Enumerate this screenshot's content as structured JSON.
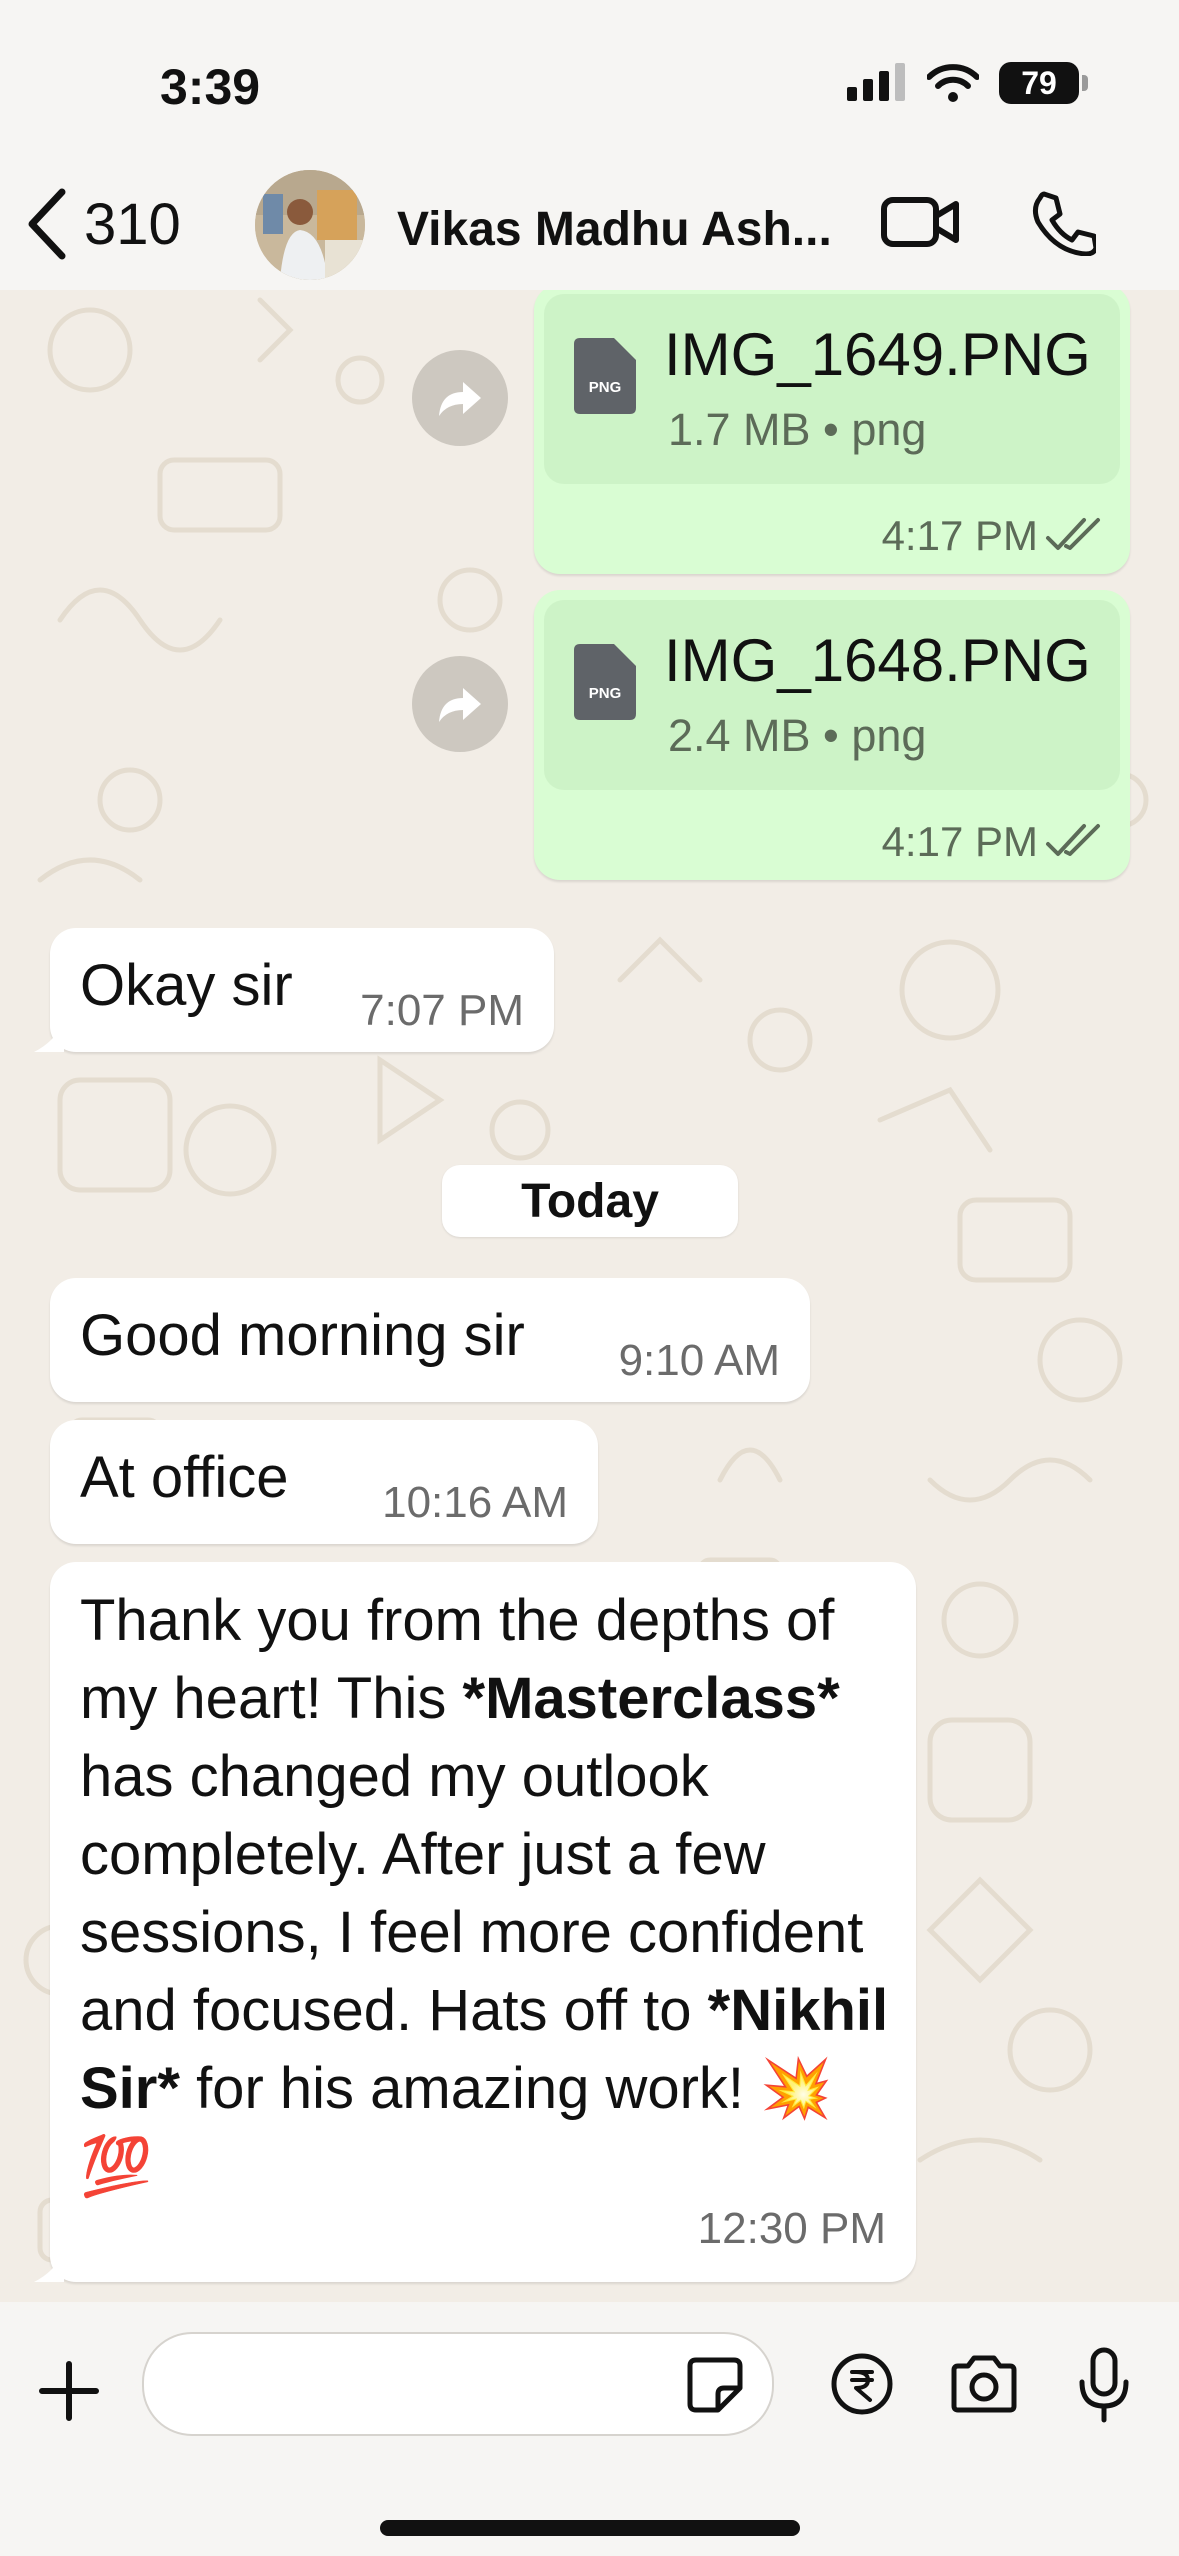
{
  "status_bar": {
    "time": "3:39",
    "battery": "79"
  },
  "header": {
    "back_count": "310",
    "contact_name": "Vikas Madhu Ash..."
  },
  "messages": {
    "file1": {
      "name": "IMG_1649.PNG",
      "meta": "1.7 MB • png",
      "time": "4:17 PM",
      "type": "PNG"
    },
    "file2": {
      "name": "IMG_1648.PNG",
      "meta": "2.4 MB • png",
      "time": "4:17 PM",
      "type": "PNG"
    },
    "m1": {
      "text": "Okay sir",
      "time": "7:07 PM"
    },
    "day_separator": "Today",
    "m2": {
      "text": "Good morning sir",
      "time": "9:10 AM"
    },
    "m3": {
      "text": "At office",
      "time": "10:16 AM"
    },
    "m4": {
      "part1": "Thank you from the depths of my heart! This ",
      "bold1": "*Masterclass*",
      "part2": " has changed my outlook completely. After just a few sessions, I feel more confident and focused. Hats off to ",
      "bold2": "*Nikhil Sir*",
      "part3": " for his amazing work! 💥 💯",
      "time": "12:30 PM"
    }
  },
  "input_bar": {
    "value": "",
    "placeholder": ""
  },
  "colors": {
    "outgoing": "#d9fdd3",
    "incoming": "#ffffff",
    "background": "#f2ede6"
  }
}
